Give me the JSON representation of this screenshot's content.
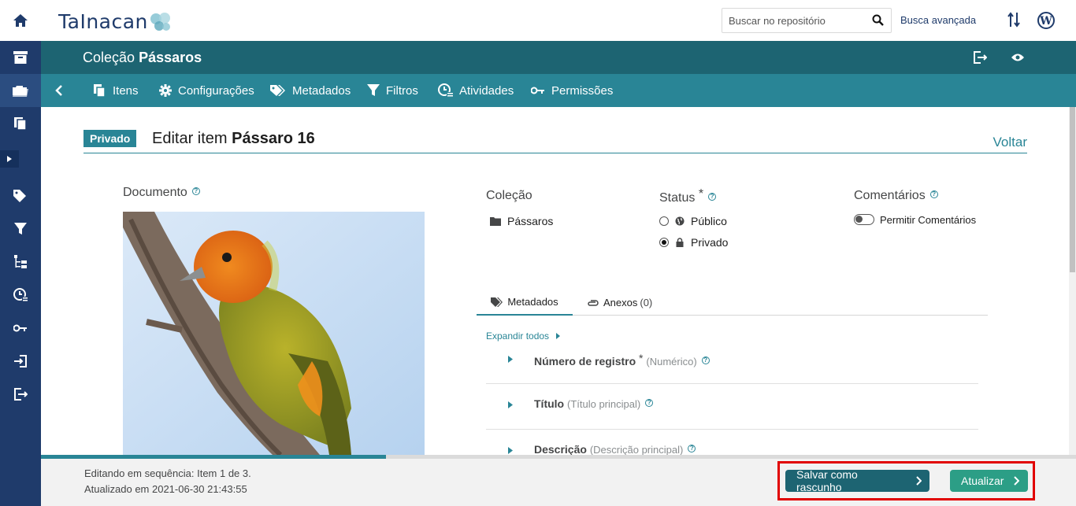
{
  "app": {
    "logo_text": "TaInacan"
  },
  "header": {
    "search_placeholder": "Buscar no repositório",
    "advanced_search": "Busca avançada"
  },
  "collection": {
    "prefix": "Coleção",
    "name": "Pássaros"
  },
  "collection_nav": [
    {
      "label": "Itens",
      "icon": "items-icon"
    },
    {
      "label": "Configurações",
      "icon": "gear-icon"
    },
    {
      "label": "Metadados",
      "icon": "tags-icon"
    },
    {
      "label": "Filtros",
      "icon": "filter-icon"
    },
    {
      "label": "Atividades",
      "icon": "activities-icon"
    },
    {
      "label": "Permissões",
      "icon": "key-icon"
    }
  ],
  "page": {
    "badge": "Privado",
    "title_prefix": "Editar item",
    "title_item": "Pássaro 16",
    "back": "Voltar"
  },
  "document": {
    "label": "Documento"
  },
  "collection_field": {
    "label": "Coleção",
    "value": "Pássaros"
  },
  "status": {
    "label": "Status",
    "required_mark": "*",
    "options": [
      {
        "label": "Público",
        "selected": false,
        "icon": "globe-icon"
      },
      {
        "label": "Privado",
        "selected": true,
        "icon": "lock-icon"
      }
    ]
  },
  "comments": {
    "label": "Comentários",
    "toggle_label": "Permitir Comentários",
    "enabled": false
  },
  "tabs": {
    "metadata": "Metadados",
    "attachments": "Anexos",
    "attachments_count": "(0)"
  },
  "expand_all": "Expandir todos",
  "metadata_fields": [
    {
      "label": "Número de registro",
      "required": "*",
      "type": "(Numérico)"
    },
    {
      "label": "Título",
      "required": "",
      "type": "(Título principal)"
    },
    {
      "label": "Descrição",
      "required": "",
      "type": "(Descrição principal)"
    }
  ],
  "footer": {
    "sequence_info": "Editando em sequência: Item 1 de 3.",
    "updated_info": "Atualizado em 2021-06-30 21:43:55",
    "draft_button": "Salvar como rascunho",
    "update_button": "Atualizar",
    "progress_fraction": 0.333
  },
  "colors": {
    "primary": "#298596",
    "dark": "#1d6472",
    "sidebar": "#1f3b6b",
    "success": "#2c9e86",
    "highlight": "#e10000"
  }
}
